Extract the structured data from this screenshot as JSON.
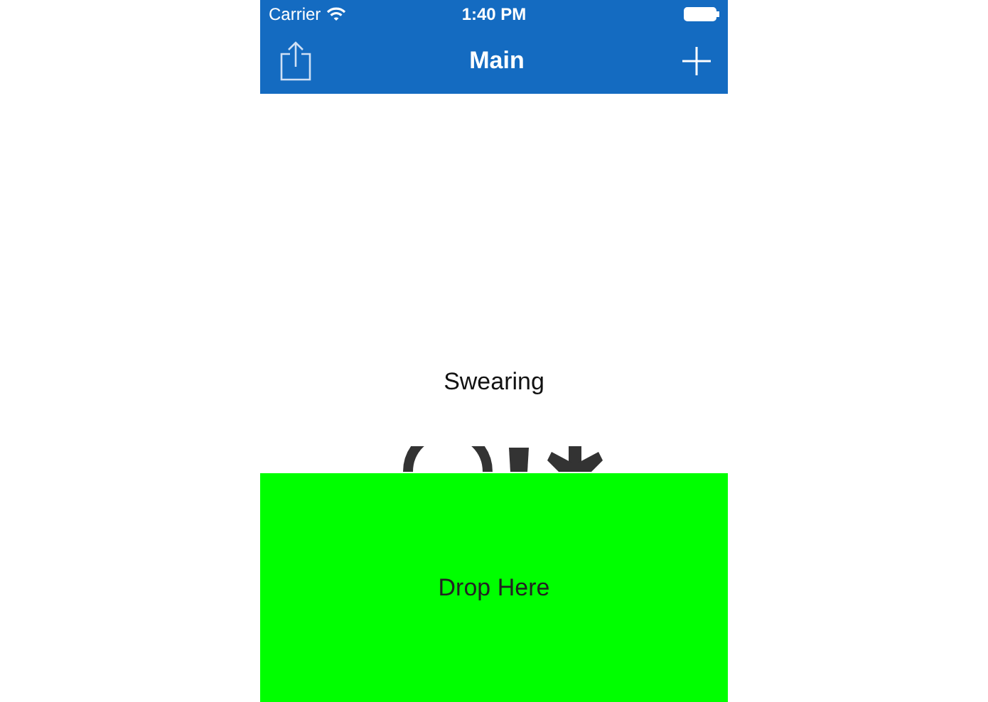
{
  "status_bar": {
    "carrier": "Carrier",
    "time": "1:40 PM"
  },
  "nav_bar": {
    "title": "Main"
  },
  "content": {
    "label": "Swearing"
  },
  "drop_zone": {
    "label": "Drop Here"
  }
}
